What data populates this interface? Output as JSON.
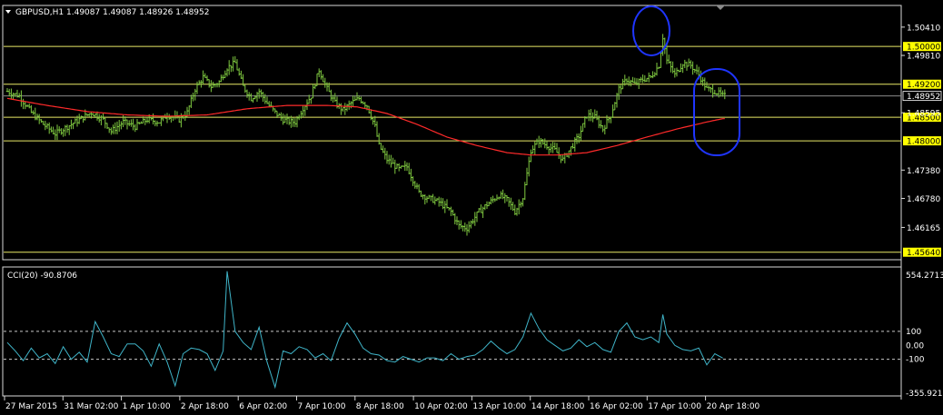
{
  "header": {
    "price_title": "GBPUSD,H1  1.49087 1.49087 1.48926 1.48952",
    "cci_title": "CCI(20) -90.8706"
  },
  "colors": {
    "background": "#000000",
    "frame": "#d8d8d8",
    "bars": "#7fc940",
    "ma": "#ff2a2a",
    "hline": "#e8e866",
    "tag_bg": "#ffff00",
    "cci_line": "#3fb4c8",
    "ellipse": "#1f35ff",
    "text": "#ffffff"
  },
  "chart_data": [
    {
      "type": "bar",
      "title": "GBPUSD,H1",
      "ohlc_last": {
        "open": 1.49087,
        "high": 1.49087,
        "low": 1.48926,
        "close": 1.48952
      },
      "ylim": [
        1.455,
        1.5085
      ],
      "price_axis_ticks": [
        "1.50410",
        "1.49810",
        "1.48595",
        "1.47380",
        "1.46780",
        "1.46165"
      ],
      "current_price": "1.48952",
      "horizontal_levels": [
        {
          "value": 1.5,
          "label": "1.50000"
        },
        {
          "value": 1.492,
          "label": "1.49200"
        },
        {
          "value": 1.485,
          "label": "1.48500"
        },
        {
          "value": 1.48,
          "label": "1.48000"
        },
        {
          "value": 1.4564,
          "label": "1.45640"
        }
      ],
      "x_labels": [
        "27 Mar 2015",
        "31 Mar 02:00",
        "1 Apr 10:00",
        "2 Apr 18:00",
        "6 Apr 02:00",
        "7 Apr 10:00",
        "8 Apr 18:00",
        "10 Apr 02:00",
        "13 Apr 10:00",
        "14 Apr 18:00",
        "16 Apr 02:00",
        "17 Apr 10:00",
        "20 Apr 18:00"
      ],
      "price_path": [
        [
          0,
          1.4905
        ],
        [
          6,
          1.4895
        ],
        [
          12,
          1.486
        ],
        [
          18,
          1.4835
        ],
        [
          24,
          1.4815
        ],
        [
          30,
          1.483
        ],
        [
          36,
          1.4845
        ],
        [
          42,
          1.486
        ],
        [
          48,
          1.4845
        ],
        [
          52,
          1.482
        ],
        [
          58,
          1.484
        ],
        [
          64,
          1.483
        ],
        [
          70,
          1.4845
        ],
        [
          76,
          1.484
        ],
        [
          80,
          1.4855
        ],
        [
          86,
          1.4845
        ],
        [
          90,
          1.486
        ],
        [
          94,
          1.491
        ],
        [
          98,
          1.4935
        ],
        [
          102,
          1.4915
        ],
        [
          106,
          1.4925
        ],
        [
          110,
          1.4955
        ],
        [
          114,
          1.4965
        ],
        [
          118,
          1.4915
        ],
        [
          122,
          1.489
        ],
        [
          126,
          1.4905
        ],
        [
          130,
          1.488
        ],
        [
          134,
          1.486
        ],
        [
          138,
          1.4845
        ],
        [
          142,
          1.484
        ],
        [
          144,
          1.484
        ],
        [
          148,
          1.487
        ],
        [
          152,
          1.4895
        ],
        [
          156,
          1.495
        ],
        [
          160,
          1.491
        ],
        [
          164,
          1.488
        ],
        [
          168,
          1.4865
        ],
        [
          172,
          1.488
        ],
        [
          176,
          1.489
        ],
        [
          180,
          1.4875
        ],
        [
          184,
          1.483
        ],
        [
          186,
          1.479
        ],
        [
          190,
          1.476
        ],
        [
          196,
          1.474
        ],
        [
          200,
          1.4745
        ],
        [
          206,
          1.469
        ],
        [
          210,
          1.468
        ],
        [
          216,
          1.467
        ],
        [
          222,
          1.465
        ],
        [
          226,
          1.462
        ],
        [
          230,
          1.4615
        ],
        [
          236,
          1.465
        ],
        [
          240,
          1.4665
        ],
        [
          246,
          1.4685
        ],
        [
          250,
          1.4675
        ],
        [
          254,
          1.465
        ],
        [
          258,
          1.468
        ],
        [
          262,
          1.478
        ],
        [
          266,
          1.48
        ],
        [
          270,
          1.479
        ],
        [
          274,
          1.478
        ],
        [
          278,
          1.476
        ],
        [
          282,
          1.4785
        ],
        [
          286,
          1.481
        ],
        [
          290,
          1.4855
        ],
        [
          294,
          1.485
        ],
        [
          298,
          1.4825
        ],
        [
          302,
          1.4855
        ],
        [
          306,
          1.491
        ],
        [
          310,
          1.493
        ],
        [
          314,
          1.492
        ],
        [
          318,
          1.493
        ],
        [
          322,
          1.4935
        ],
        [
          326,
          1.496
        ],
        [
          328,
          1.502
        ],
        [
          330,
          1.497
        ],
        [
          334,
          1.494
        ],
        [
          338,
          1.4965
        ],
        [
          342,
          1.496
        ],
        [
          346,
          1.494
        ],
        [
          350,
          1.491
        ],
        [
          354,
          1.4905
        ],
        [
          358,
          1.4895
        ]
      ],
      "ma_path": [
        [
          0,
          1.489
        ],
        [
          20,
          1.4875
        ],
        [
          40,
          1.4862
        ],
        [
          60,
          1.4855
        ],
        [
          80,
          1.4852
        ],
        [
          100,
          1.4855
        ],
        [
          120,
          1.4868
        ],
        [
          140,
          1.4875
        ],
        [
          160,
          1.4875
        ],
        [
          175,
          1.4872
        ],
        [
          190,
          1.4858
        ],
        [
          205,
          1.4835
        ],
        [
          220,
          1.4808
        ],
        [
          235,
          1.479
        ],
        [
          250,
          1.4775
        ],
        [
          262,
          1.477
        ],
        [
          275,
          1.477
        ],
        [
          290,
          1.4775
        ],
        [
          305,
          1.479
        ],
        [
          320,
          1.4808
        ],
        [
          335,
          1.4825
        ],
        [
          350,
          1.484
        ],
        [
          358,
          1.4847
        ]
      ]
    },
    {
      "type": "line",
      "title": "CCI(20) -90.8706",
      "ylim": [
        -355.9219,
        554.2713
      ],
      "axis_labels": [
        "554.2713",
        "100",
        "0.00",
        "-100",
        "-355.9219"
      ],
      "reference_levels": [
        100,
        -100
      ],
      "cci_path": [
        [
          0,
          20
        ],
        [
          4,
          -40
        ],
        [
          8,
          -110
        ],
        [
          12,
          -20
        ],
        [
          16,
          -90
        ],
        [
          20,
          -60
        ],
        [
          24,
          -130
        ],
        [
          28,
          -10
        ],
        [
          32,
          -100
        ],
        [
          36,
          -50
        ],
        [
          40,
          -120
        ],
        [
          44,
          170
        ],
        [
          48,
          60
        ],
        [
          52,
          -60
        ],
        [
          56,
          -80
        ],
        [
          60,
          10
        ],
        [
          64,
          10
        ],
        [
          68,
          -40
        ],
        [
          72,
          -150
        ],
        [
          76,
          10
        ],
        [
          80,
          -120
        ],
        [
          84,
          -290
        ],
        [
          88,
          -60
        ],
        [
          92,
          -20
        ],
        [
          96,
          -30
        ],
        [
          100,
          -60
        ],
        [
          104,
          -180
        ],
        [
          108,
          -40
        ],
        [
          110,
          530
        ],
        [
          114,
          100
        ],
        [
          118,
          20
        ],
        [
          122,
          -30
        ],
        [
          126,
          130
        ],
        [
          130,
          -120
        ],
        [
          134,
          -300
        ],
        [
          138,
          -40
        ],
        [
          142,
          -60
        ],
        [
          146,
          -10
        ],
        [
          150,
          -30
        ],
        [
          154,
          -90
        ],
        [
          158,
          -60
        ],
        [
          162,
          -110
        ],
        [
          166,
          50
        ],
        [
          170,
          160
        ],
        [
          174,
          80
        ],
        [
          178,
          -20
        ],
        [
          182,
          -60
        ],
        [
          186,
          -70
        ],
        [
          190,
          -110
        ],
        [
          194,
          -120
        ],
        [
          198,
          -80
        ],
        [
          202,
          -100
        ],
        [
          206,
          -120
        ],
        [
          210,
          -90
        ],
        [
          214,
          -90
        ],
        [
          218,
          -110
        ],
        [
          222,
          -60
        ],
        [
          226,
          -100
        ],
        [
          230,
          -80
        ],
        [
          234,
          -70
        ],
        [
          238,
          -30
        ],
        [
          242,
          30
        ],
        [
          246,
          -20
        ],
        [
          250,
          -60
        ],
        [
          254,
          -30
        ],
        [
          258,
          60
        ],
        [
          262,
          230
        ],
        [
          266,
          120
        ],
        [
          270,
          40
        ],
        [
          274,
          0
        ],
        [
          278,
          -40
        ],
        [
          282,
          -20
        ],
        [
          286,
          40
        ],
        [
          290,
          -10
        ],
        [
          294,
          20
        ],
        [
          298,
          -30
        ],
        [
          302,
          -50
        ],
        [
          306,
          100
        ],
        [
          310,
          160
        ],
        [
          314,
          60
        ],
        [
          318,
          40
        ],
        [
          322,
          60
        ],
        [
          326,
          20
        ],
        [
          328,
          220
        ],
        [
          330,
          80
        ],
        [
          334,
          0
        ],
        [
          338,
          -30
        ],
        [
          342,
          -40
        ],
        [
          346,
          -20
        ],
        [
          350,
          -140
        ],
        [
          354,
          -60
        ],
        [
          358,
          -91
        ]
      ]
    }
  ]
}
